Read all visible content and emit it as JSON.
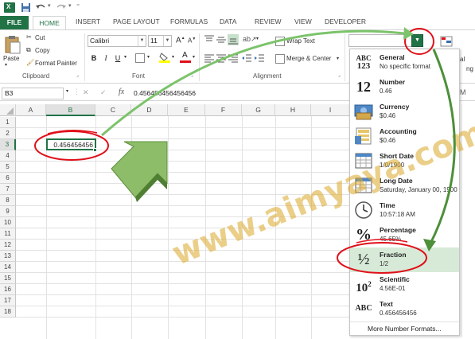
{
  "tabs": {
    "file": "FILE",
    "home": "HOME",
    "insert": "INSERT",
    "page_layout": "PAGE LAYOUT",
    "formulas": "FORMULAS",
    "data": "DATA",
    "review": "REVIEW",
    "view": "VIEW",
    "developer": "DEVELOPER"
  },
  "clipboard": {
    "paste": "Paste",
    "cut": "Cut",
    "copy": "Copy",
    "format_painter": "Format Painter",
    "label": "Clipboard"
  },
  "font": {
    "name": "Calibri",
    "size": "11",
    "label": "Font",
    "bold": "B",
    "italic": "I",
    "underline": "U"
  },
  "alignment": {
    "wrap_text": "Wrap Text",
    "merge_center": "Merge & Center",
    "label": "Alignment"
  },
  "number_format": {
    "current": ""
  },
  "formula_bar": {
    "name_box": "B3",
    "fx": "fx",
    "cancel": "✕",
    "enter": "✓",
    "value": "0.456456456456456"
  },
  "grid": {
    "columns": [
      "A",
      "B",
      "C",
      "D",
      "E",
      "F",
      "G",
      "H",
      "I"
    ],
    "rows": [
      "1",
      "2",
      "3",
      "4",
      "5",
      "6",
      "7",
      "8",
      "9",
      "10",
      "11",
      "12",
      "13",
      "14",
      "15",
      "16",
      "17",
      "18"
    ],
    "active_cell_value": "0.456456456"
  },
  "format_menu": {
    "items": [
      {
        "name": "General",
        "example": "No specific format",
        "icon": "ABC\n123"
      },
      {
        "name": "Number",
        "example": "0.46",
        "icon": "12"
      },
      {
        "name": "Currency",
        "example": "$0.46",
        "icon": "currency"
      },
      {
        "name": "Accounting",
        "example": "$0.46",
        "icon": "accounting"
      },
      {
        "name": "Short Date",
        "example": "1/0/1900",
        "icon": "calendar"
      },
      {
        "name": "Long Date",
        "example": "Saturday, January 00, 1900",
        "icon": "calendar"
      },
      {
        "name": "Time",
        "example": "10:57:18 AM",
        "icon": "clock"
      },
      {
        "name": "Percentage",
        "example": "45.65%",
        "icon": "%"
      },
      {
        "name": "Fraction",
        "example": "1/2",
        "icon": "½"
      },
      {
        "name": "Scientific",
        "example": "4.56E-01",
        "icon": "10²"
      },
      {
        "name": "Text",
        "example": "0.456456456",
        "icon": "ABC"
      }
    ],
    "more": "More Number Formats..."
  },
  "partial_labels": {
    "al": "al",
    "m": "M",
    "ng": "ng"
  },
  "watermark": "www.aimyaya.com",
  "colors": {
    "excel_green": "#217346",
    "annotation_red": "#e0101a",
    "annotation_green": "#7cc36b",
    "selected_item": "#d7ead8"
  }
}
